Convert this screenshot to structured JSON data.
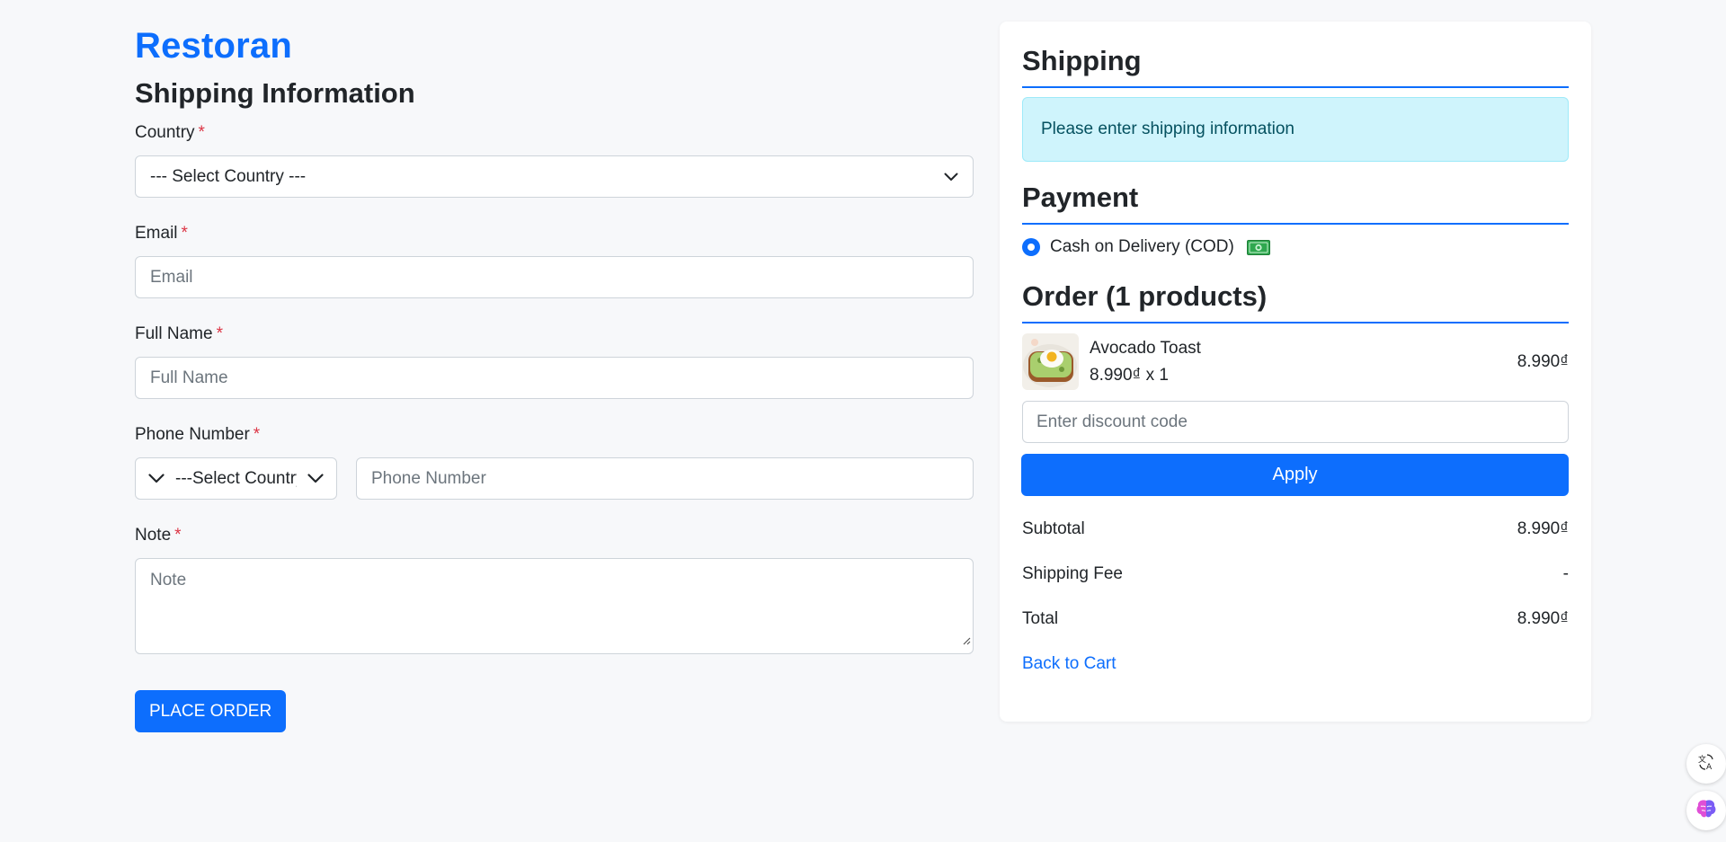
{
  "brand": "Restoran",
  "shipping_form": {
    "title": "Shipping Information",
    "required_marker": "*",
    "country": {
      "label": "Country",
      "value": "--- Select Country ---"
    },
    "email": {
      "label": "Email",
      "placeholder": "Email"
    },
    "full_name": {
      "label": "Full Name",
      "placeholder": "Full Name"
    },
    "phone": {
      "label": "Phone Number",
      "country_code_value": "---Select Country---",
      "placeholder": "Phone Number"
    },
    "note": {
      "label": "Note",
      "placeholder": "Note"
    },
    "place_order_label": "PLACE ORDER"
  },
  "summary": {
    "shipping_title": "Shipping",
    "shipping_alert": "Please enter shipping information",
    "payment_title": "Payment",
    "payment_method": "Cash on Delivery (COD)",
    "order_title": "Order (1 products)",
    "items": [
      {
        "name": "Avocado Toast",
        "unit_line": "8.990₫ x 1",
        "price": "8.990₫"
      }
    ],
    "discount_placeholder": "Enter discount code",
    "apply_label": "Apply",
    "subtotal_label": "Subtotal",
    "subtotal_value": "8.990₫",
    "shipping_fee_label": "Shipping Fee",
    "shipping_fee_value": "-",
    "total_label": "Total",
    "total_value": "8.990₫",
    "back_link": "Back to Cart"
  },
  "colors": {
    "accent": "#0d6efd",
    "required": "#dc3545",
    "alert_bg": "#cff4fc",
    "alert_text": "#055160"
  },
  "icons": [
    "chevron-down-icon",
    "cash-icon",
    "resize-handle-icon",
    "translate-icon",
    "brain-icon"
  ]
}
